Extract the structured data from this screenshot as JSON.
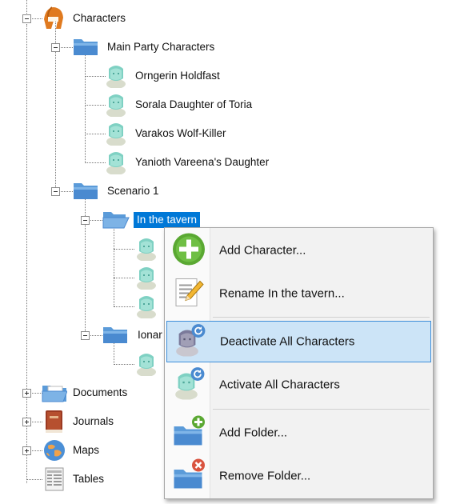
{
  "tree": {
    "characters": "Characters",
    "main_party": "Main Party Characters",
    "main_party_members": [
      "Orngerin Holdfast",
      "Sorala Daughter of Toria",
      "Varakos Wolf-Killer",
      "Yanioth Vareena's Daughter"
    ],
    "scenario": "Scenario 1",
    "in_tavern": "In the tavern",
    "ionar_partial": "Ionar",
    "documents": "Documents",
    "journals": "Journals",
    "maps": "Maps",
    "tables": "Tables"
  },
  "context_menu": {
    "add_character": "Add Character...",
    "rename": "Rename In the tavern...",
    "deactivate_all": "Deactivate All Characters",
    "activate_all": "Activate All Characters",
    "add_folder": "Add Folder...",
    "remove_folder": "Remove Folder..."
  },
  "colors": {
    "selection": "#0078d7",
    "hover_fill": "#cce4f7",
    "hover_border": "#3e8ed9",
    "folder": "#4a90d9",
    "character": "#7fd1c3",
    "add_green": "#5aa832",
    "remove_red": "#d9533f"
  }
}
